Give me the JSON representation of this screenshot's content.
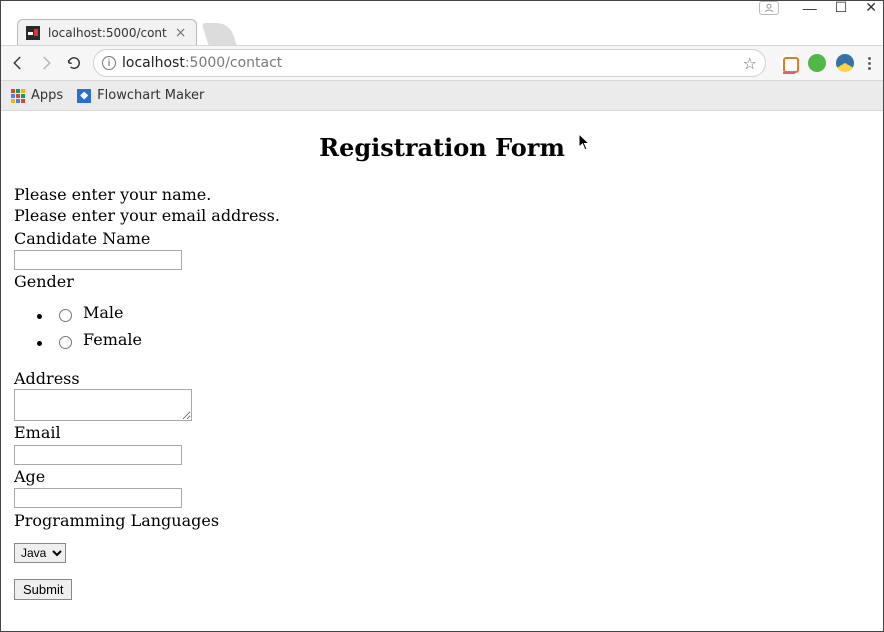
{
  "window": {
    "tab_title": "localhost:5000/cont",
    "minimize": "—",
    "maximize": "☐",
    "close": "✕"
  },
  "toolbar": {
    "url_host": "localhost",
    "url_rest": ":5000/contact"
  },
  "bookmarks": {
    "apps": "Apps",
    "flowchart": "Flowchart Maker"
  },
  "page": {
    "heading": "Registration Form",
    "flash_name": "Please enter your name.",
    "flash_email": "Please enter your email address.",
    "label_name": "Candidate Name",
    "label_gender": "Gender",
    "gender_male": "Male",
    "gender_female": "Female",
    "label_address": "Address",
    "label_email": "Email",
    "label_age": "Age",
    "label_lang": "Programming Languages",
    "lang_selected": "Java",
    "submit": "Submit"
  }
}
